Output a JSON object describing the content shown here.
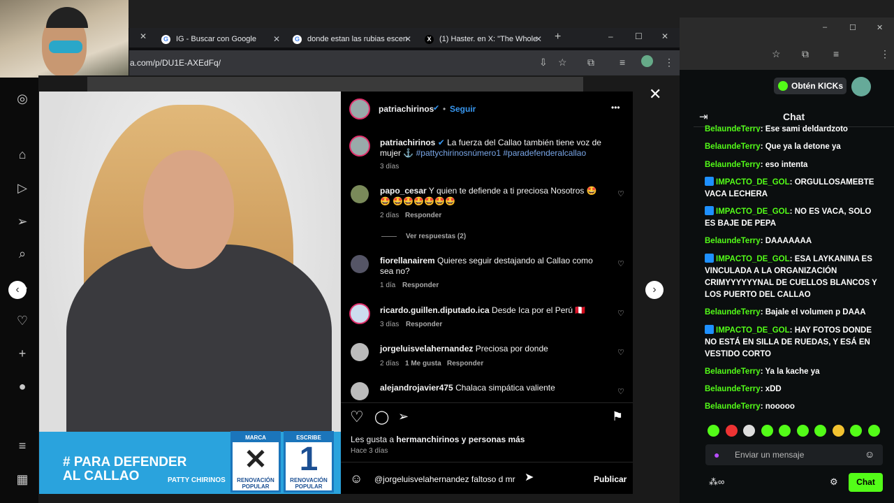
{
  "browser": {
    "tabs": [
      {
        "title": "IG - Buscar con Google",
        "icon": "google-icon"
      },
      {
        "title": "donde estan las rubias escen",
        "icon": "google-icon"
      },
      {
        "title": "(1) Haster. en X: \"The Whole",
        "icon": "x-icon"
      }
    ],
    "new_tab": "+",
    "url": "a.com/p/DU1E-AXEdFq/",
    "window_controls": [
      "–",
      "☐",
      "✕"
    ]
  },
  "instagram": {
    "post_author": "patriachirinos",
    "follow_label": "Seguir",
    "more_label": "•••",
    "caption_user": "patriachirinos",
    "caption_text": "La fuerza del Callao también tiene voz de mujer ⚓ ",
    "caption_tags": "#pattychirinosnúmero1 #paradefenderalcallao",
    "caption_time": "3 días",
    "comments": [
      {
        "user": "papo_cesar",
        "text": "Y quien te defiende a ti preciosa Nosotros 🤩🤩 🤩🤩🤩🤩🤩🤩",
        "time": "2 días",
        "likes": "",
        "reply": "Responder"
      },
      {
        "user": "fiorellanairem",
        "text": "Quieres seguir destajando al Callao como sea no?",
        "time": "1 día",
        "likes": "",
        "reply": "Responder"
      },
      {
        "user": "ricardo.guillen.diputado.ica",
        "text": "Desde Ica por el Perú 🇵🇪",
        "time": "3 días",
        "likes": "",
        "reply": "Responder"
      },
      {
        "user": "jorgeluisvelahernandez",
        "text": "Preciosa por donde",
        "time": "2 días",
        "likes": "1 Me gusta",
        "reply": "Responder"
      },
      {
        "user": "alejandrojavier475",
        "text": "Chalaca simpática valiente",
        "time": "",
        "likes": "",
        "reply": ""
      }
    ],
    "view_replies": "Ver respuestas (2)",
    "likes_prefix": "Les gusta a ",
    "likes_user": "hermanchirinos",
    "likes_suffix": " y personas más",
    "posted_time": "Hace 3 días",
    "comment_input": "@jorgeluisvelahernandez faltoso d mr",
    "publish_label": "Publicar",
    "banner_line1": "# PARA DEFENDER",
    "banner_line2": "AL CALLAO",
    "banner_name": "PATTY CHIRINOS",
    "ballot_marca": "MARCA",
    "ballot_escribe": "ESCRIBE",
    "ballot_number": "1",
    "ballot_party": "RENOVACIÓN POPULAR"
  },
  "kick": {
    "kicks_button": "Obtén KICKs",
    "chat_title": "Chat",
    "messages": [
      {
        "user": "BelaundeTerry",
        "text": "Ese sami deldardzoto",
        "badge": false
      },
      {
        "user": "BelaundeTerry",
        "text": "Que ya la detone ya",
        "badge": false
      },
      {
        "user": "BelaundeTerry",
        "text": "eso intenta",
        "badge": false
      },
      {
        "user": "IMPACTO_DE_GOL",
        "text": "ORGULLOSAMEBTE VACA LECHERA",
        "badge": true
      },
      {
        "user": "IMPACTO_DE_GOL",
        "text": "NO ES VACA, SOLO ES BAJE DE PEPA",
        "badge": true
      },
      {
        "user": "BelaundeTerry",
        "text": "DAAAAAAA",
        "badge": false
      },
      {
        "user": "IMPACTO_DE_GOL",
        "text": "ESA LAYKANINA ES VINCULADA A LA ORGANIZACIÓN CRIMYYYYYYNAL DE CUELLOS BLANCOS Y LOS PUERTO DEL CALLAO",
        "badge": true
      },
      {
        "user": "BelaundeTerry",
        "text": "Bajale el volumen p DAAA",
        "badge": false
      },
      {
        "user": "IMPACTO_DE_GOL",
        "text": "HAY FOTOS DONDE NO ESTÁ EN SILLA DE RUEDAS, Y ESÁ EN VESTIDO CORTO",
        "badge": true
      },
      {
        "user": "BelaundeTerry",
        "text": "Ya la kache ya",
        "badge": false
      },
      {
        "user": "BelaundeTerry",
        "text": "xDD",
        "badge": false
      },
      {
        "user": "BelaundeTerry",
        "text": "nooooo",
        "badge": false
      }
    ],
    "input_placeholder": "Enviar un mensaje",
    "chat_button": "Chat",
    "accent": "#53fc18"
  }
}
